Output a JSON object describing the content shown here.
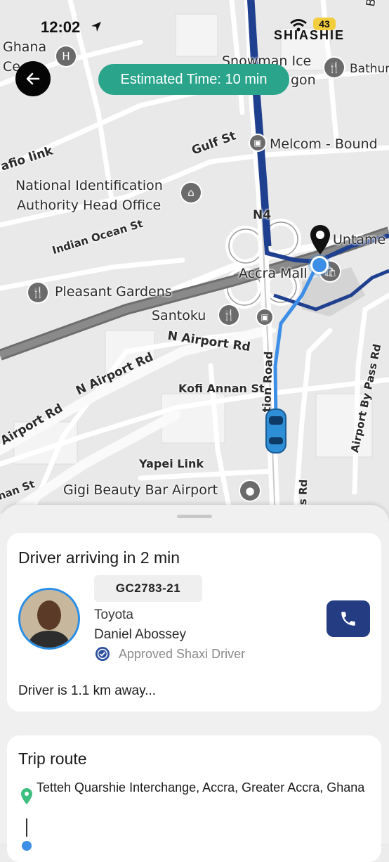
{
  "status_bar": {
    "time": "12:02",
    "carrier": "SHIASHIE",
    "battery": "43"
  },
  "map": {
    "labels": {
      "ghana": "Ghana",
      "ghana_ce": "Ce",
      "snowman": "Snowman Ice",
      "gon": "gon",
      "bathur": "Bathur",
      "bis": "Bis",
      "gulf": "Gulf St",
      "melcom": "Melcom - Bound",
      "afio": "afio link",
      "nia1": "National Identification",
      "nia2": "Authority Head Office",
      "indian": "Indian Ocean St",
      "n4": "N4",
      "untame": "Untame",
      "accra_mall": "Accra Mall",
      "pleasant": "Pleasant Gardens",
      "santoku": "Santoku",
      "n_airport_rd": "N Airport Rd",
      "n_airport_rd2": "N Airport Rd",
      "airport_rd": "Airport Rd",
      "airport_bypass": "Airport By Pass Rd",
      "kofi": "Kofi Annan St",
      "tion_road": "tion Road",
      "yapei": "Yapei Link",
      "gigi": "Gigi Beauty Bar Airport",
      "nan_st": "nan St",
      "s_rd": "s Rd"
    }
  },
  "eta_pill": {
    "label": "Estimated Time: 10 min"
  },
  "driver_card": {
    "title": "Driver arriving in 2 min",
    "plate": "GC2783-21",
    "car": "Toyota",
    "driver_name": "Daniel Abossey",
    "approved": "Approved Shaxi Driver",
    "distance": "Driver is 1.1 km away..."
  },
  "trip_card": {
    "title": "Trip route",
    "pickup": "Tetteh Quarshie Interchange, Accra, Greater Accra, Ghana"
  },
  "colors": {
    "accent": "#2aa58b",
    "call": "#243d82",
    "route": "#1f3f8f",
    "route_light": "#3d8ee6"
  }
}
